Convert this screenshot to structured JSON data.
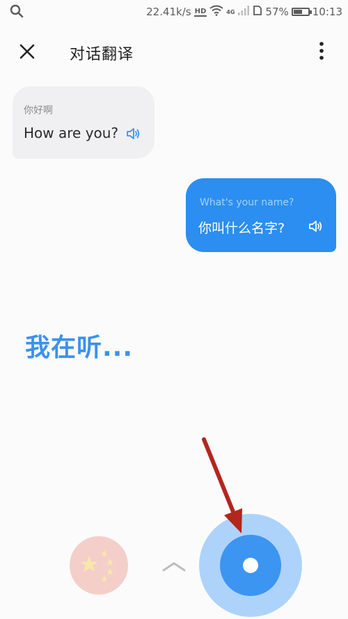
{
  "status_bar": {
    "speed": "22.41k/s",
    "hd": "HD",
    "network": "4G",
    "battery_percent": "57%",
    "battery_level": 0.57,
    "time": "10:13",
    "icons": [
      "search-icon",
      "wifi-icon",
      "signal-icon",
      "sim-icon",
      "battery-icon"
    ]
  },
  "header": {
    "title": "对话翻译",
    "close_icon": "close-icon",
    "more_icon": "more-vertical-icon"
  },
  "conversation": [
    {
      "side": "left",
      "original": "你好啊",
      "translation": "How are you?",
      "icon": "speaker-icon"
    },
    {
      "side": "right",
      "original": "What's your name?",
      "translation": "你叫什么名字?",
      "icon": "speaker-icon"
    }
  ],
  "listening": {
    "text": "我在听..."
  },
  "controls": {
    "language_flag": "china-flag-icon",
    "switch_icon": "chevron-up-icon",
    "mic_icon": "microphone-button"
  },
  "colors": {
    "accent": "#2b8ef0",
    "listening_text": "#3b92ec",
    "mic_outer": "#aed3fb",
    "annotation_arrow": "#b3261e"
  }
}
